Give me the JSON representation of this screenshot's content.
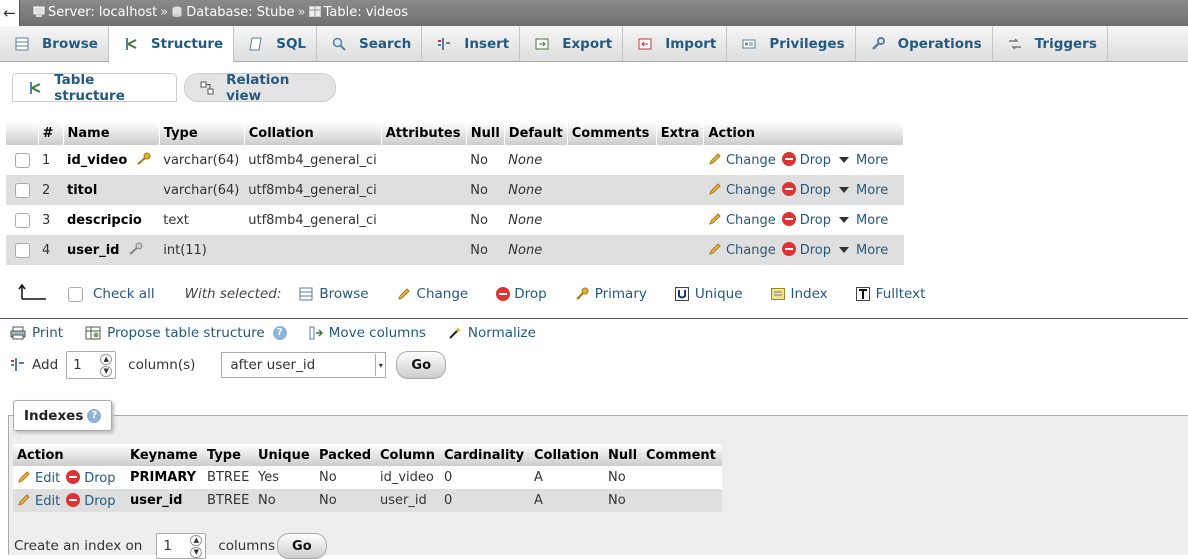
{
  "breadcrumb": {
    "back": "←",
    "server": "Server: localhost",
    "database": "Database: Stube",
    "table": "Table: videos",
    "sep": "»"
  },
  "tabs": [
    {
      "label": "Browse",
      "icon": "browse-icon"
    },
    {
      "label": "Structure",
      "icon": "structure-icon",
      "active": true
    },
    {
      "label": "SQL",
      "icon": "sql-icon"
    },
    {
      "label": "Search",
      "icon": "search-icon"
    },
    {
      "label": "Insert",
      "icon": "insert-icon"
    },
    {
      "label": "Export",
      "icon": "export-icon"
    },
    {
      "label": "Import",
      "icon": "import-icon"
    },
    {
      "label": "Privileges",
      "icon": "privileges-icon"
    },
    {
      "label": "Operations",
      "icon": "operations-icon"
    },
    {
      "label": "Triggers",
      "icon": "triggers-icon"
    }
  ],
  "subtabs": {
    "table_structure": "Table structure",
    "relation_view": "Relation view"
  },
  "structure": {
    "headers": [
      "#",
      "Name",
      "Type",
      "Collation",
      "Attributes",
      "Null",
      "Default",
      "Comments",
      "Extra",
      "Action"
    ],
    "rows": [
      {
        "num": "1",
        "name": "id_video",
        "key": "primary",
        "type": "varchar(64)",
        "collation": "utf8mb4_general_ci",
        "attributes": "",
        "null": "No",
        "default": "None",
        "comments": "",
        "extra": ""
      },
      {
        "num": "2",
        "name": "titol",
        "key": "",
        "type": "varchar(64)",
        "collation": "utf8mb4_general_ci",
        "attributes": "",
        "null": "No",
        "default": "None",
        "comments": "",
        "extra": ""
      },
      {
        "num": "3",
        "name": "descripcio",
        "key": "",
        "type": "text",
        "collation": "utf8mb4_general_ci",
        "attributes": "",
        "null": "No",
        "default": "None",
        "comments": "",
        "extra": ""
      },
      {
        "num": "4",
        "name": "user_id",
        "key": "index",
        "type": "int(11)",
        "collation": "",
        "attributes": "",
        "null": "No",
        "default": "None",
        "comments": "",
        "extra": ""
      }
    ],
    "actions": {
      "change": "Change",
      "drop": "Drop",
      "more": "More"
    }
  },
  "with_selected": {
    "check_all": "Check all",
    "label": "With selected:",
    "browse": "Browse",
    "change": "Change",
    "drop": "Drop",
    "primary": "Primary",
    "unique": "Unique",
    "index": "Index",
    "fulltext": "Fulltext"
  },
  "tools": {
    "print": "Print",
    "propose": "Propose table structure",
    "move": "Move columns",
    "normalize": "Normalize"
  },
  "add_column": {
    "add": "Add",
    "count": "1",
    "columns_label": "column(s)",
    "position": "after user_id",
    "go": "Go"
  },
  "indexes": {
    "legend": "Indexes",
    "headers": [
      "Action",
      "Keyname",
      "Type",
      "Unique",
      "Packed",
      "Column",
      "Cardinality",
      "Collation",
      "Null",
      "Comment"
    ],
    "rows": [
      {
        "keyname": "PRIMARY",
        "type": "BTREE",
        "unique": "Yes",
        "packed": "No",
        "column": "id_video",
        "cardinality": "0",
        "collation": "A",
        "null": "No",
        "comment": ""
      },
      {
        "keyname": "user_id",
        "type": "BTREE",
        "unique": "No",
        "packed": "No",
        "column": "user_id",
        "cardinality": "0",
        "collation": "A",
        "null": "No",
        "comment": ""
      }
    ],
    "edit": "Edit",
    "drop": "Drop"
  },
  "create_index": {
    "label": "Create an index on",
    "count": "1",
    "columns_label": "columns",
    "go": "Go"
  },
  "colors": {
    "link": "#235a81",
    "topbar": "#7a7a7a",
    "row_even": "#dfdfdf",
    "drop_red": "#dd3333",
    "key_gold": "#d4a017"
  }
}
